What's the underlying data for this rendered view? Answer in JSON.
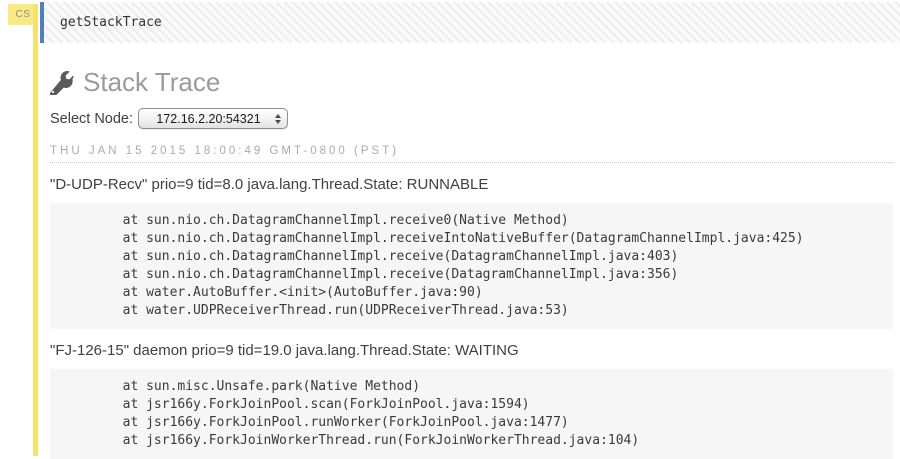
{
  "cell": {
    "badge_label": "CS",
    "input": "getStackTrace"
  },
  "output": {
    "title": "Stack Trace",
    "title_icon": "wrench-icon",
    "select_node_label": "Select Node:",
    "selected_node": "172.16.2.20:54321",
    "timestamp": "THU JAN 15 2015 18:00:49 GMT-0800 (PST)",
    "threads": [
      {
        "header": "\"D-UDP-Recv\" prio=9 tid=8.0 java.lang.Thread.State: RUNNABLE",
        "frames": [
          "at sun.nio.ch.DatagramChannelImpl.receive0(Native Method)",
          "at sun.nio.ch.DatagramChannelImpl.receiveIntoNativeBuffer(DatagramChannelImpl.java:425)",
          "at sun.nio.ch.DatagramChannelImpl.receive(DatagramChannelImpl.java:403)",
          "at sun.nio.ch.DatagramChannelImpl.receive(DatagramChannelImpl.java:356)",
          "at water.AutoBuffer.<init>(AutoBuffer.java:90)",
          "at water.UDPReceiverThread.run(UDPReceiverThread.java:53)"
        ]
      },
      {
        "header": "\"FJ-126-15\" daemon prio=9 tid=19.0 java.lang.Thread.State: WAITING",
        "frames": [
          "at sun.misc.Unsafe.park(Native Method)",
          "at jsr166y.ForkJoinPool.scan(ForkJoinPool.java:1594)",
          "at jsr166y.ForkJoinPool.runWorker(ForkJoinPool.java:1477)",
          "at jsr166y.ForkJoinWorkerThread.run(ForkJoinWorkerThread.java:104)"
        ]
      }
    ]
  },
  "colors": {
    "badge_bg": "#FBE983",
    "highlight_line": "#F5E26D",
    "cell_border": "#4E81BD",
    "title_text": "#9B9B9B",
    "icon_gray": "#5A5A5A",
    "muted_text": "#ABABAB",
    "body_text": "#404040",
    "code_text": "#3A3A3A",
    "code_bg": "#F6F6F6"
  }
}
